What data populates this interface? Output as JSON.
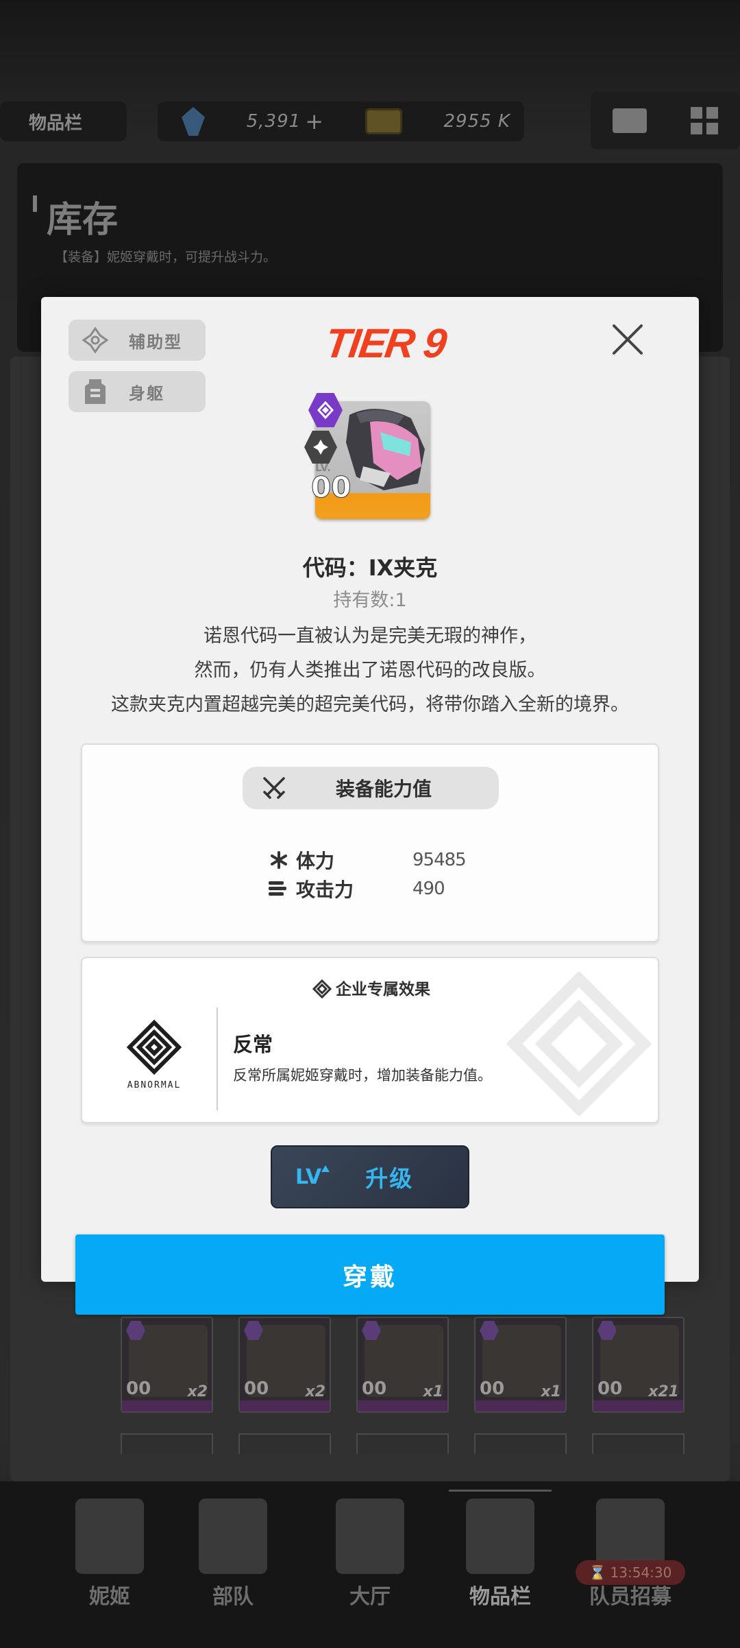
{
  "topbar": {
    "inventory_tab": "物品栏",
    "gems": "5,391",
    "gems_plus": "+",
    "credits": "2955 K"
  },
  "inventory": {
    "title": "库存",
    "subtitle": "【装备】妮姬穿戴时，可提升战斗力。",
    "slots": [
      {
        "lv": "00",
        "count": "x2"
      },
      {
        "lv": "00",
        "count": "x2"
      },
      {
        "lv": "00",
        "count": "x1"
      },
      {
        "lv": "00",
        "count": "x1"
      },
      {
        "lv": "00",
        "count": "x21"
      }
    ]
  },
  "modal": {
    "tags": [
      {
        "label": "辅助型",
        "icon": "support-class-icon"
      },
      {
        "label": "身躯",
        "icon": "body-armor-icon"
      }
    ],
    "tier": "TIER 9",
    "item": {
      "lv_label": "LV.",
      "lv": "00",
      "rarity_color": "#7a3ac8",
      "name": "代码：IX夹克",
      "count": "持有数:1",
      "description": [
        "诺恩代码一直被认为是完美无瑕的神作，",
        "然而，仍有人类推出了诺恩代码的改良版。",
        "这款夹克内置超越完美的超完美代码，将带你踏入全新的境界。"
      ]
    },
    "stats": {
      "header": "装备能力值",
      "rows": [
        {
          "label": "体力",
          "value": "95485",
          "icon": "hp-asterisk-icon"
        },
        {
          "label": "攻击力",
          "value": "490",
          "icon": "attack-bullets-icon"
        }
      ]
    },
    "corp": {
      "header": "企业专属效果",
      "logo_text": "ABNORMAL",
      "name": "反常",
      "description": "反常所属妮姬穿戴时，增加装备能力值。"
    },
    "upgrade": {
      "lv": "LV",
      "label": "升级"
    },
    "equip_label": "穿戴"
  },
  "nav": {
    "items": [
      "妮姬",
      "部队",
      "大厅",
      "物品栏",
      "队员招募"
    ],
    "timer": "13:54:30"
  },
  "colors": {
    "accent": "#05a9f5",
    "tier": "#ef4020",
    "upgrade_text": "#35b6f0"
  }
}
